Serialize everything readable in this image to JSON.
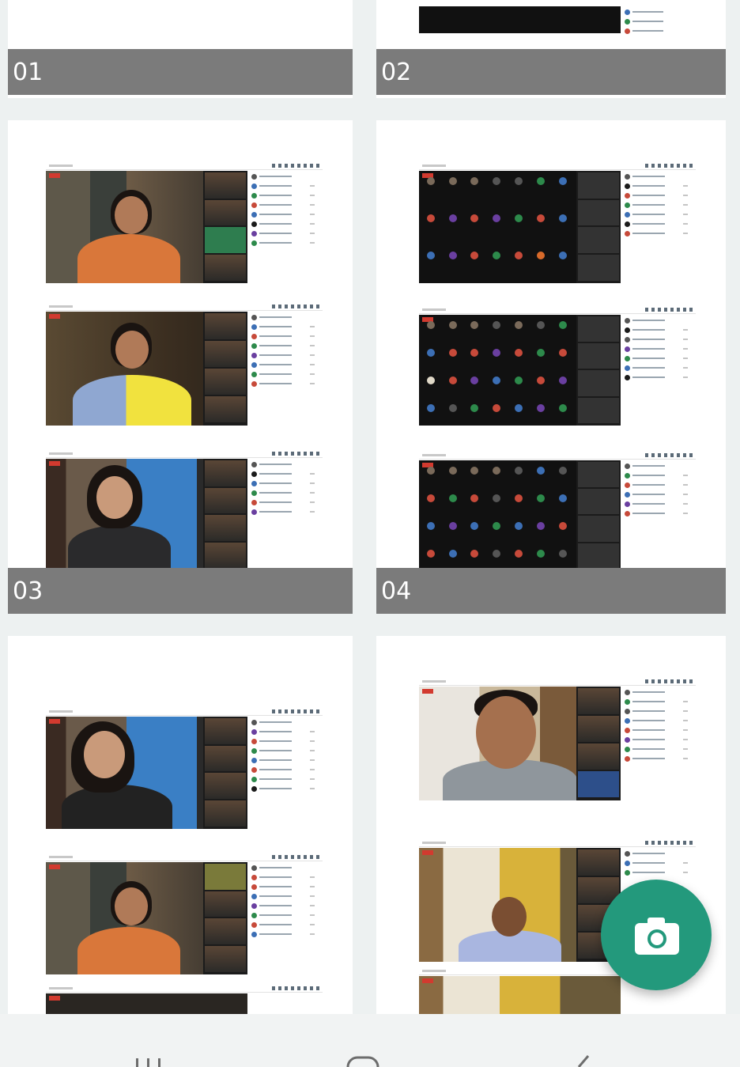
{
  "albums": [
    {
      "label": "01"
    },
    {
      "label": "02"
    },
    {
      "label": "03"
    },
    {
      "label": "04"
    },
    {
      "label": ""
    },
    {
      "label": ""
    }
  ],
  "fab": {
    "icon": "camera-icon",
    "color": "#23997c"
  },
  "navbar": {
    "icons": [
      "recent-apps-icon",
      "home-icon",
      "back-icon"
    ]
  },
  "colors": {
    "label_bg": "#7b7b7b",
    "background": "#edf1f1"
  }
}
